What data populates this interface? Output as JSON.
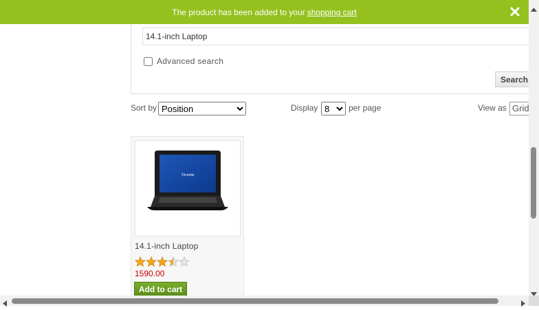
{
  "notification": {
    "message": "The product has been added to your",
    "link_text": "shopping cart",
    "close_icon": "close-icon"
  },
  "search": {
    "value": "14.1-inch Laptop",
    "advanced_label": "Advanced search",
    "advanced_checked": false,
    "button_label": "Search"
  },
  "toolbar": {
    "sort_label": "Sort by",
    "sort_selected": "Position",
    "display_label": "Display",
    "display_selected": "8",
    "per_page_label": "per page",
    "view_label": "View as",
    "view_selected": "Grid"
  },
  "products": [
    {
      "title": "14.1-inch Laptop",
      "price": "1590.00",
      "rating_stars": 3.5,
      "rating_max": 5,
      "add_to_cart_label": "Add to cart",
      "screen_brand": "Tricentis"
    }
  ],
  "colors": {
    "notify_bg": "#95c11f",
    "price": "#cc0000",
    "button_green": "#6a9e24",
    "star": "#f3a51b"
  }
}
